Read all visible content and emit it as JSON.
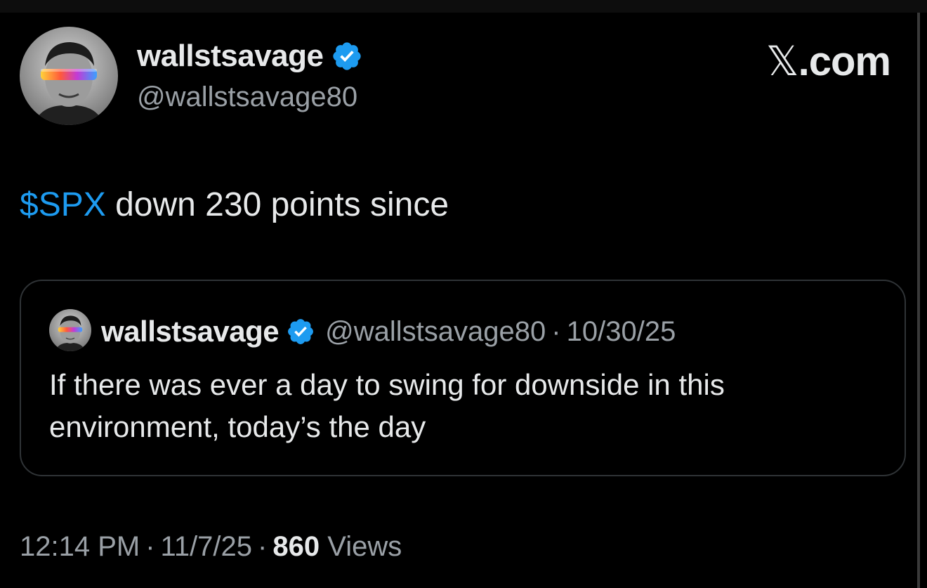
{
  "author": {
    "name": "wallstsavage",
    "handle": "@wallstsavage80",
    "verified": true
  },
  "brand": {
    "logo_text": ".com",
    "logo_glyph": "𝕏"
  },
  "tweet": {
    "cashtag": "$SPX",
    "text_rest": " down 230 points since"
  },
  "quote": {
    "name": "wallstsavage",
    "handle": "@wallstsavage80",
    "separator": "·",
    "date": "10/30/25",
    "text": "If there was ever a day to swing for downside in this environment, today’s the day"
  },
  "meta": {
    "time": "12:14 PM",
    "separator": "·",
    "date": "11/7/25",
    "views_count": "860",
    "views_label": " Views"
  },
  "colors": {
    "background": "#000000",
    "text_primary": "#e7e9ea",
    "text_secondary": "#9aa0a6",
    "accent_link": "#1d9bf0",
    "verified_badge": "#1d9bf0",
    "border": "#2f3336"
  },
  "icons": {
    "verified": "verified-badge-icon",
    "avatar": "avatar-image"
  }
}
